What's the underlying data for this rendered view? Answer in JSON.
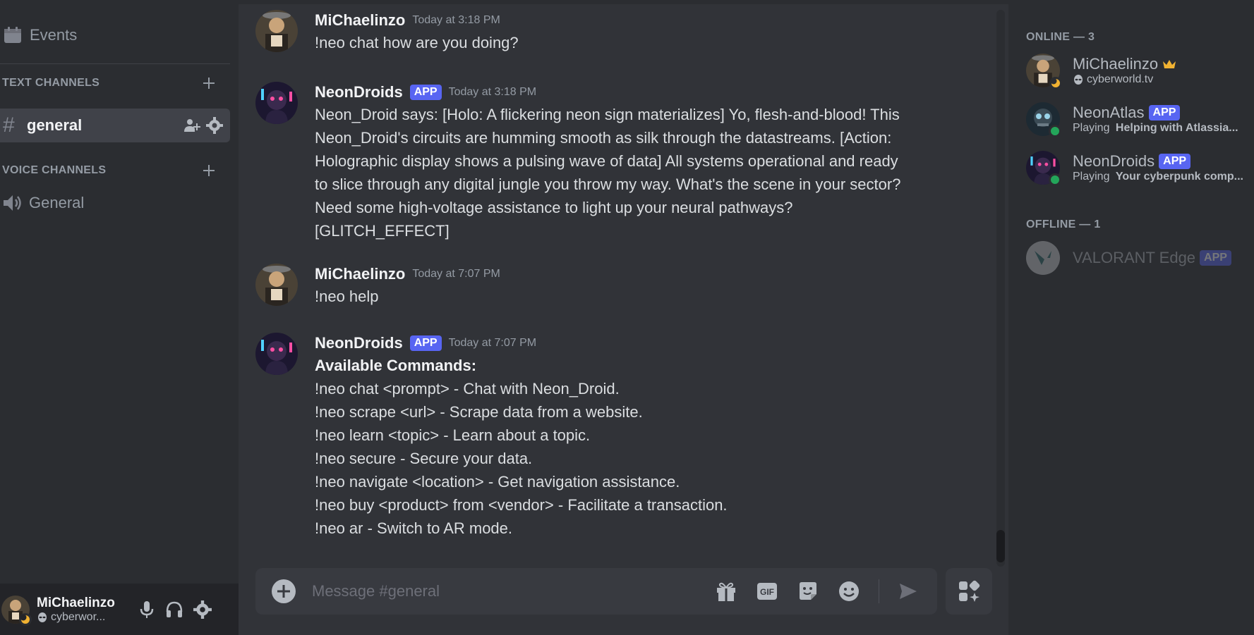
{
  "sidebar": {
    "events_label": "Events",
    "text_category": "TEXT CHANNELS",
    "active_channel": "general",
    "voice_category": "VOICE CHANNELS",
    "voice_channel": "General"
  },
  "user_panel": {
    "name": "MiChaelinzo",
    "status": "cyberwor..."
  },
  "messages": [
    {
      "author": "MiChaelinzo",
      "time": "Today at 3:18 PM",
      "lines": [
        "!neo chat how are you doing?"
      ]
    },
    {
      "author": "NeonDroids",
      "badge": "APP",
      "time": "Today at 3:18 PM",
      "lines": [
        "Neon_Droid says: [Holo: A flickering neon sign materializes] Yo, flesh-and-blood! This",
        "Neon_Droid's circuits are humming smooth as silk through the datastreams. [Action:",
        "Holographic display shows a pulsing wave of data] All systems operational and ready",
        "to slice through any digital jungle you throw my way. What's the scene in your sector?",
        "Need some high-voltage assistance to light up your neural pathways?",
        "[GLITCH_EFFECT]"
      ]
    },
    {
      "author": "MiChaelinzo",
      "time": "Today at 7:07 PM",
      "lines": [
        "!neo help"
      ]
    },
    {
      "author": "NeonDroids",
      "badge": "APP",
      "time": "Today at 7:07 PM",
      "heading": "Available Commands:",
      "lines": [
        "!neo chat <prompt> - Chat with Neon_Droid.",
        "!neo scrape <url> - Scrape data from a website.",
        "!neo learn <topic> - Learn about a topic.",
        "!neo secure - Secure your data.",
        "!neo navigate <location> - Get navigation assistance.",
        "!neo buy <product> from <vendor> - Facilitate a transaction.",
        "!neo ar - Switch to AR mode."
      ]
    }
  ],
  "composer": {
    "placeholder": "Message #general",
    "gif_label": "GIF"
  },
  "members": {
    "online_header": "ONLINE — 3",
    "offline_header": "OFFLINE — 1",
    "online": [
      {
        "name": "MiChaelinzo",
        "status": "cyberworld.tv"
      },
      {
        "name": "NeonAtlas",
        "badge": "APP",
        "activity_prefix": "Playing ",
        "activity": "Helping with Atlassia..."
      },
      {
        "name": "NeonDroids",
        "badge": "APP",
        "activity_prefix": "Playing ",
        "activity": "Your cyberpunk comp..."
      }
    ],
    "offline": [
      {
        "name": "VALORANT Edge",
        "badge": "APP"
      }
    ]
  },
  "colors": {
    "blurple": "#5865f2",
    "online": "#23a55a",
    "crown": "#f0b232"
  }
}
